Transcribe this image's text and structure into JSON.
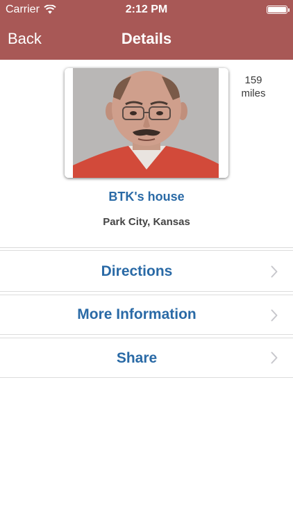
{
  "status_bar": {
    "carrier": "Carrier",
    "time": "2:12 PM",
    "battery_level": 1.0
  },
  "nav": {
    "back_label": "Back",
    "title": "Details"
  },
  "place": {
    "distance_value": "159",
    "distance_unit": "miles",
    "name": "BTK's house",
    "location": "Park City, Kansas"
  },
  "actions": [
    {
      "label": "Directions"
    },
    {
      "label": "More Information"
    },
    {
      "label": "Share"
    }
  ],
  "colors": {
    "header_bg": "#a85856",
    "accent": "#2a6aa6"
  }
}
